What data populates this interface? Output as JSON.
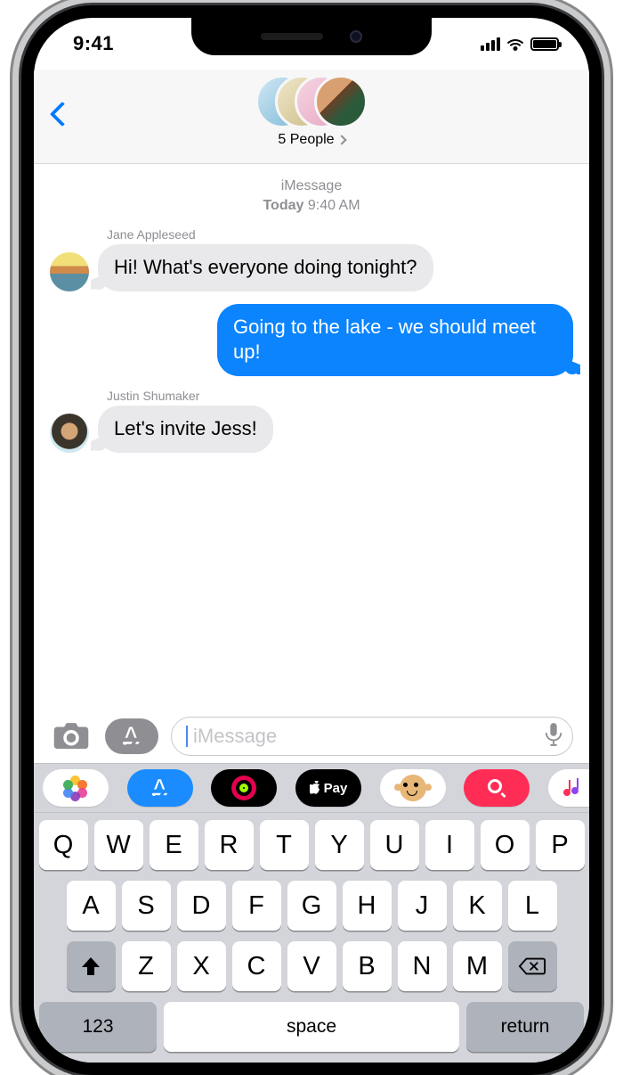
{
  "statusbar": {
    "time": "9:41"
  },
  "nav": {
    "subtitle": "5 People"
  },
  "conversation": {
    "service": "iMessage",
    "date_prefix": "Today",
    "date_time": "9:40 AM",
    "messages": [
      {
        "sender": "Jane Appleseed",
        "text": "Hi! What's everyone doing tonight?"
      },
      {
        "text": "Going to the lake - we should meet up!"
      },
      {
        "sender": "Justin Shumaker",
        "text": "Let's invite Jess!"
      }
    ]
  },
  "compose": {
    "placeholder": "iMessage"
  },
  "appstrip": {
    "pay_label": "Pay"
  },
  "keyboard": {
    "row1": [
      "Q",
      "W",
      "E",
      "R",
      "T",
      "Y",
      "U",
      "I",
      "O",
      "P"
    ],
    "row2": [
      "A",
      "S",
      "D",
      "F",
      "G",
      "H",
      "J",
      "K",
      "L"
    ],
    "row3": [
      "Z",
      "X",
      "C",
      "V",
      "B",
      "N",
      "M"
    ],
    "numKey": "123",
    "spaceKey": "space",
    "returnKey": "return"
  }
}
